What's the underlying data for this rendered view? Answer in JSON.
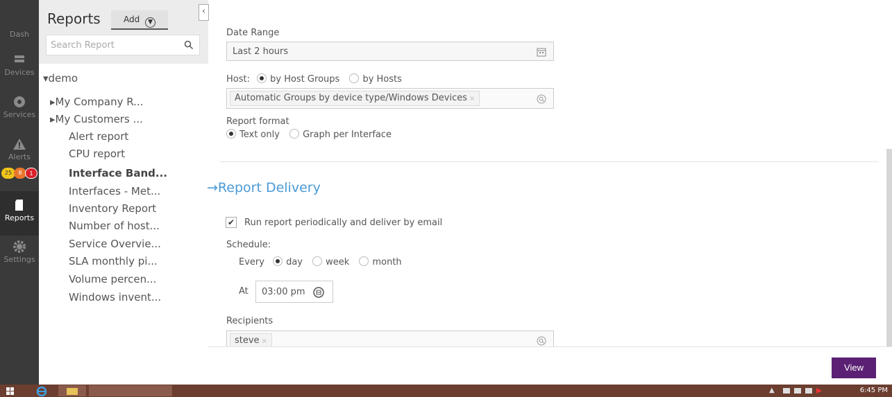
{
  "nav": {
    "items": [
      {
        "label": "Dash",
        "icon": "dashboard-icon"
      },
      {
        "label": "Devices",
        "icon": "devices-icon"
      },
      {
        "label": "Services",
        "icon": "services-icon"
      },
      {
        "label": "Alerts",
        "icon": "alert-icon"
      },
      {
        "label": "Reports",
        "icon": "report-icon"
      },
      {
        "label": "Settings",
        "icon": "gear-icon"
      }
    ],
    "badges": [
      {
        "value": "25",
        "color": "#f0c419"
      },
      {
        "value": "8",
        "color": "#e8762c"
      },
      {
        "value": "1",
        "color": "#d9222a"
      }
    ]
  },
  "reports": {
    "title": "Reports",
    "add_label": "Add",
    "search_placeholder": "Search Report",
    "root": "▾demo",
    "groups": [
      "▸My Company R...",
      "▸My Customers ..."
    ],
    "items": [
      "Alert report",
      "CPU report",
      "Interface Band...",
      "Interfaces - Met...",
      "Inventory Report",
      "Number of host...",
      "Service Overvie...",
      "SLA monthly pi...",
      "Volume percen...",
      "Windows invent..."
    ]
  },
  "form": {
    "date_range_label": "Date Range",
    "date_range_value": "Last 2 hours",
    "host_label": "Host:",
    "host_options": [
      "by Host Groups",
      "by Hosts"
    ],
    "host_tag": "Automatic Groups by device type/Windows Devices",
    "tag_remove": "×",
    "report_format_label": "Report format",
    "format_options": [
      "Text only",
      "Graph per Interface"
    ],
    "delivery_title": "→Report Delivery",
    "run_periodically_label": "Run report periodically and deliver by email",
    "schedule_label": "Schedule:",
    "every_label": "Every",
    "period_options": [
      "day",
      "week",
      "month"
    ],
    "at_label": "At",
    "time_value": "03:00 pm",
    "recipients_label": "Recipients",
    "recipient_tag": "steve",
    "view_button": "View"
  },
  "taskbar": {
    "clock": "6:45 PM"
  },
  "colors": {
    "accent": "#4a9ad6",
    "view_button": "#5b1f73",
    "nav_bg": "#3a3a3a",
    "taskbar": "#6b3e30"
  }
}
